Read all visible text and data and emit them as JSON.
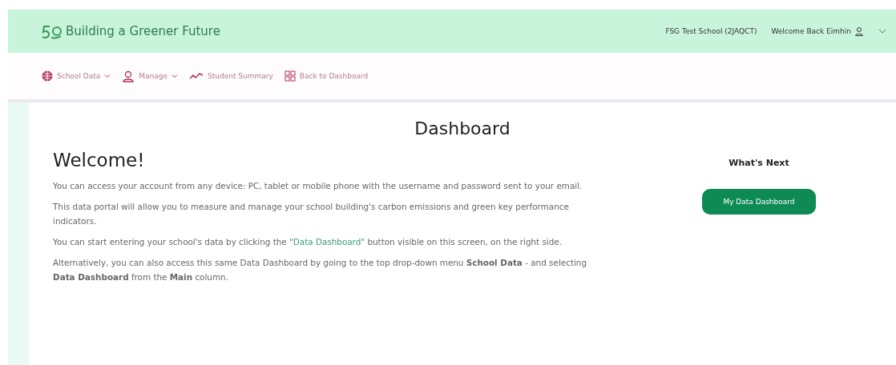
{
  "header": {
    "brand": "Building a Greener Future",
    "school": "FSG Test School (2JAQCT)",
    "welcome": "Welcome Back Eimhin"
  },
  "nav": [
    {
      "kind": "globe",
      "label": "School Data",
      "dropdown": true
    },
    {
      "kind": "user",
      "label": "Manage",
      "dropdown": true
    },
    {
      "kind": "chart",
      "label": "Student Summary",
      "dropdown": false
    },
    {
      "kind": "grid",
      "label": "Back to Dashboard",
      "dropdown": false
    }
  ],
  "page_title": "Dashboard",
  "welcome_heading": "Welcome!",
  "paragraphs": [
    {
      "text": "You can access your account from any device: PC, tablet or mobile phone with the username and password sent to your email."
    },
    {
      "text": "This data portal will allow you to measure and manage your school building's carbon emissions and green key performance indicators."
    },
    {
      "before": "You can start entering your school's data by clicking the ",
      "link": "\"Data Dashboard\"",
      "after": " button visible on this screen, on the right side."
    },
    {
      "text": "Alternatively, you can also access this same Data Dashboard by going to the top drop-down menu **School Data** - and selecting **Data Dashboard** from the **Main** column."
    }
  ],
  "whats_next": {
    "title": "What's Next",
    "button": "My Data Dashboard"
  }
}
